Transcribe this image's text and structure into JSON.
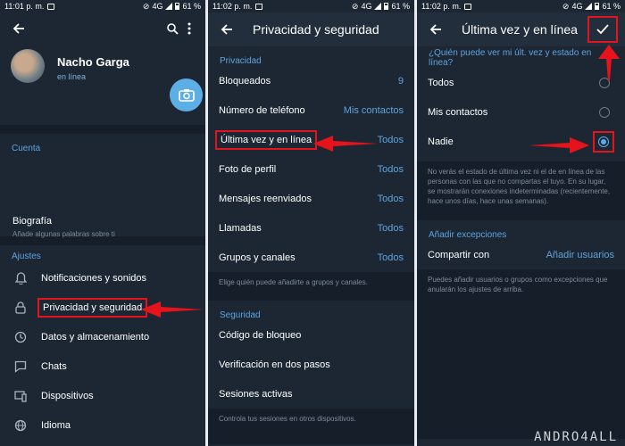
{
  "panel1": {
    "status": {
      "time": "11:01 p. m.",
      "net": "4G",
      "battery": "61 %"
    },
    "profile": {
      "name": "Nacho Garga",
      "status": "en línea"
    },
    "account_header": "Cuenta",
    "bio": {
      "title": "Biografía",
      "subtitle": "Añade algunas palabras sobre ti"
    },
    "settings_header": "Ajustes",
    "settings_items": [
      {
        "label": "Notificaciones y sonidos",
        "icon": "bell-icon"
      },
      {
        "label": "Privacidad y seguridad",
        "icon": "lock-icon"
      },
      {
        "label": "Datos y almacenamiento",
        "icon": "clock-icon"
      },
      {
        "label": "Chats",
        "icon": "chat-icon"
      },
      {
        "label": "Dispositivos",
        "icon": "device-icon"
      },
      {
        "label": "Idioma",
        "icon": "globe-icon"
      }
    ]
  },
  "panel2": {
    "status": {
      "time": "11:02 p. m.",
      "net": "4G",
      "battery": "61 %"
    },
    "title": "Privacidad y seguridad",
    "privacy_header": "Privacidad",
    "privacy_items": [
      {
        "label": "Bloqueados",
        "value": "9"
      },
      {
        "label": "Número de teléfono",
        "value": "Mis contactos"
      },
      {
        "label": "Última vez y en línea",
        "value": "Todos"
      },
      {
        "label": "Foto de perfil",
        "value": "Todos"
      },
      {
        "label": "Mensajes reenviados",
        "value": "Todos"
      },
      {
        "label": "Llamadas",
        "value": "Todos"
      },
      {
        "label": "Grupos y canales",
        "value": "Todos"
      }
    ],
    "groups_note": "Elige quién puede añadirte a grupos y canales.",
    "security_header": "Seguridad",
    "security_items": [
      {
        "label": "Código de bloqueo"
      },
      {
        "label": "Verificación en dos pasos"
      },
      {
        "label": "Sesiones activas"
      }
    ],
    "sessions_note": "Controla tus sesiones en otros dispositivos."
  },
  "panel3": {
    "status": {
      "time": "11:02 p. m.",
      "net": "4G",
      "battery": "61 %"
    },
    "title": "Última vez y en línea",
    "question": "¿Quién puede ver mi últ. vez y estado en línea?",
    "options": [
      {
        "label": "Todos",
        "selected": false
      },
      {
        "label": "Mis contactos",
        "selected": false
      },
      {
        "label": "Nadie",
        "selected": true
      }
    ],
    "note": "No verás el estado de última vez ni el de en línea de las personas con las que no compartas el tuyo. En su lugar, se mostrarán conexiones indeterminadas (recientemente, hace unos días, hace unas semanas).",
    "exceptions_header": "Añadir excepciones",
    "share_with": {
      "label": "Compartir con",
      "value": "Añadir usuarios"
    },
    "exceptions_note": "Puedes añadir usuarios o grupos como excepciones que anularán los ajustes de arriba."
  },
  "watermark": "ANDRO4ALL",
  "colors": {
    "bg": "#1d2733",
    "accent": "#5ea3e0",
    "highlight": "#e5131b"
  }
}
